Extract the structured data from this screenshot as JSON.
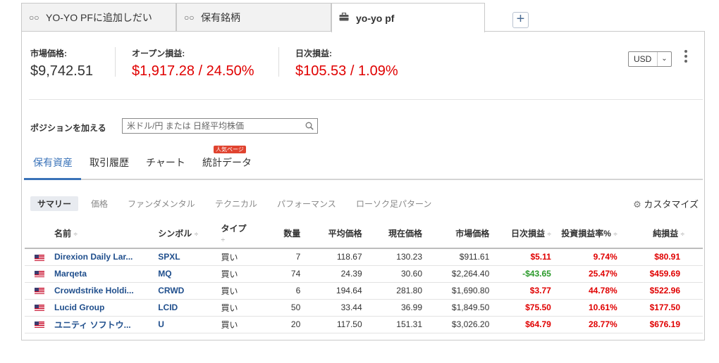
{
  "portfolio_tabs": [
    {
      "label": "YO-YO PFに追加しだい",
      "icon": "binoculars-icon"
    },
    {
      "label": "保有銘柄",
      "icon": "binoculars-icon"
    },
    {
      "label": "yo-yo pf",
      "icon": "briefcase-icon"
    }
  ],
  "add_tab_label": "+",
  "summary": {
    "market_value_label": "市場価格:",
    "market_value": "$9,742.51",
    "open_pl_label": "オープン損益:",
    "open_pl": "$1,917.28 / 24.50%",
    "daily_pl_label": "日次損益:",
    "daily_pl": "$105.53 / 1.09%"
  },
  "currency": {
    "selected": "USD",
    "chevron": "⌄"
  },
  "add_position": {
    "label": "ポジションを加える",
    "placeholder": "米ドル/円 または 日経平均株価"
  },
  "sub_tabs": [
    {
      "label": "保有資産"
    },
    {
      "label": "取引履歴"
    },
    {
      "label": "チャート"
    },
    {
      "label": "統計データ"
    }
  ],
  "badge": "人気ページ",
  "views": [
    "サマリー",
    "価格",
    "ファンダメンタル",
    "テクニカル",
    "パフォーマンス",
    "ローソク足パターン"
  ],
  "customize_label": "カスタマイズ",
  "columns": {
    "name": "名前",
    "symbol": "シンボル",
    "type": "タイプ",
    "qty": "数量",
    "avg": "平均価格",
    "price": "現在価格",
    "mkt": "市場価格",
    "daily": "日次損益",
    "ret": "投資損益率%",
    "net": "純損益",
    "sort_mark": "÷"
  },
  "rows": [
    {
      "name": "Direxion Daily Lar...",
      "symbol": "SPXL",
      "type": "買い",
      "qty": "7",
      "avg": "118.67",
      "price": "130.23",
      "mkt": "$911.61",
      "daily": "$5.11",
      "daily_color": "red",
      "ret": "9.74%",
      "net": "$80.91"
    },
    {
      "name": "Marqeta",
      "symbol": "MQ",
      "type": "買い",
      "qty": "74",
      "avg": "24.39",
      "price": "30.60",
      "mkt": "$2,264.40",
      "daily": "-$43.65",
      "daily_color": "green",
      "ret": "25.47%",
      "net": "$459.69"
    },
    {
      "name": "Crowdstrike Holdi...",
      "symbol": "CRWD",
      "type": "買い",
      "qty": "6",
      "avg": "194.64",
      "price": "281.80",
      "mkt": "$1,690.80",
      "daily": "$3.77",
      "daily_color": "red",
      "ret": "44.78%",
      "net": "$522.96"
    },
    {
      "name": "Lucid Group",
      "symbol": "LCID",
      "type": "買い",
      "qty": "50",
      "avg": "33.44",
      "price": "36.99",
      "mkt": "$1,849.50",
      "daily": "$75.50",
      "daily_color": "red",
      "ret": "10.61%",
      "net": "$177.50"
    },
    {
      "name": "ユニティ ソフトウ...",
      "symbol": "U",
      "type": "買い",
      "qty": "20",
      "avg": "117.50",
      "price": "151.31",
      "mkt": "$3,026.20",
      "daily": "$64.79",
      "daily_color": "red",
      "ret": "28.77%",
      "net": "$676.19"
    }
  ],
  "colors": {
    "accent": "#3972b8",
    "loss": "#e00000",
    "gain": "#2a9a2a",
    "badge": "#e0432f"
  }
}
